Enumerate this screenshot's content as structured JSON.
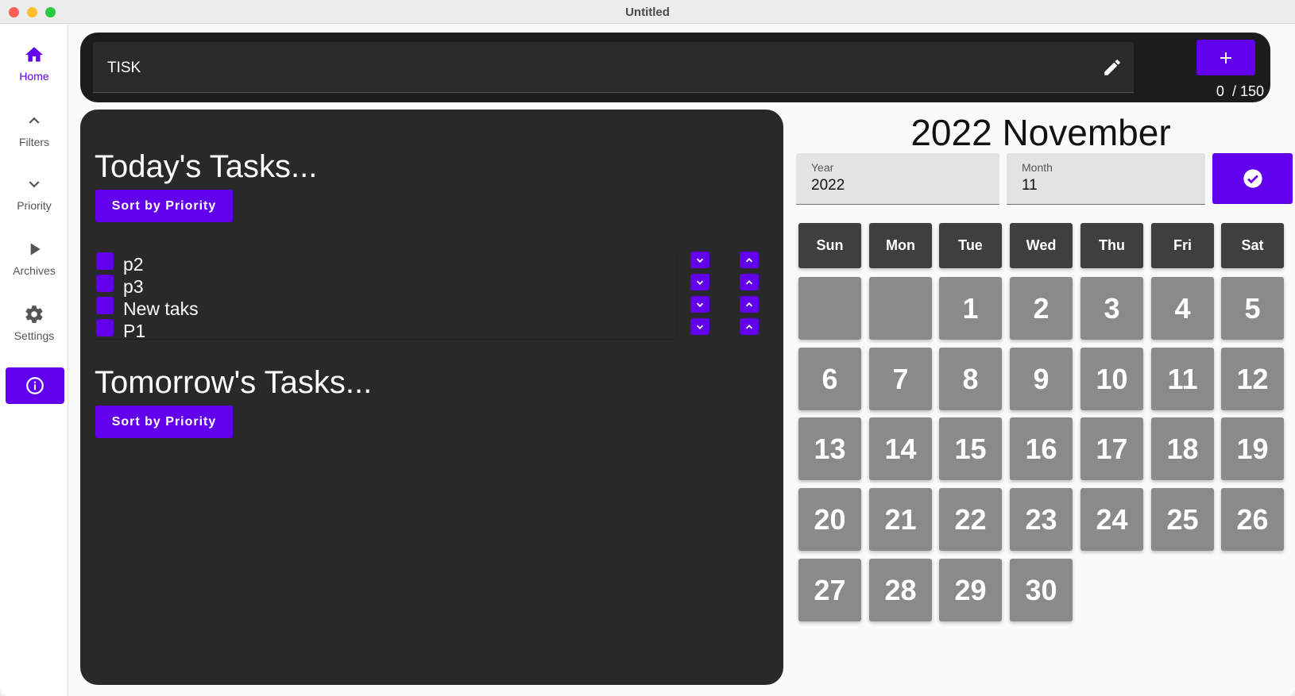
{
  "window": {
    "title": "Untitled"
  },
  "sidebar": {
    "items": [
      {
        "label": "Home",
        "icon": "home-icon",
        "active": true
      },
      {
        "label": "Filters",
        "icon": "chevron-up-icon"
      },
      {
        "label": "Priority",
        "icon": "chevron-down-icon"
      },
      {
        "label": "Archives",
        "icon": "play-icon"
      },
      {
        "label": "Settings",
        "icon": "gear-icon"
      }
    ],
    "info_icon": "info-icon"
  },
  "topbar": {
    "task_input_value": "TISK",
    "counter_current": "0",
    "counter_sep": "/ 150"
  },
  "today": {
    "title": "Today's Tasks...",
    "sort_label": "Sort by Priority",
    "tasks": [
      {
        "label": "p2"
      },
      {
        "label": "p3"
      },
      {
        "label": "New taks"
      },
      {
        "label": "P1"
      }
    ]
  },
  "tomorrow": {
    "title": "Tomorrow's Tasks...",
    "sort_label": "Sort by Priority"
  },
  "calendar": {
    "title": "2022 November",
    "year_label": "Year",
    "year_value": "2022",
    "month_label": "Month",
    "month_value": "11",
    "weekdays": [
      "Sun",
      "Mon",
      "Tue",
      "Wed",
      "Thu",
      "Fri",
      "Sat"
    ],
    "leading_blanks": 2,
    "days": [
      "1",
      "2",
      "3",
      "4",
      "5",
      "6",
      "7",
      "8",
      "9",
      "10",
      "11",
      "12",
      "13",
      "14",
      "15",
      "16",
      "17",
      "18",
      "19",
      "20",
      "21",
      "22",
      "23",
      "24",
      "25",
      "26",
      "27",
      "28",
      "29",
      "30"
    ]
  },
  "colors": {
    "accent": "#6200ee",
    "panel": "#292929",
    "day_cell": "#8a8a8a",
    "day_head": "#3f3f3f"
  }
}
